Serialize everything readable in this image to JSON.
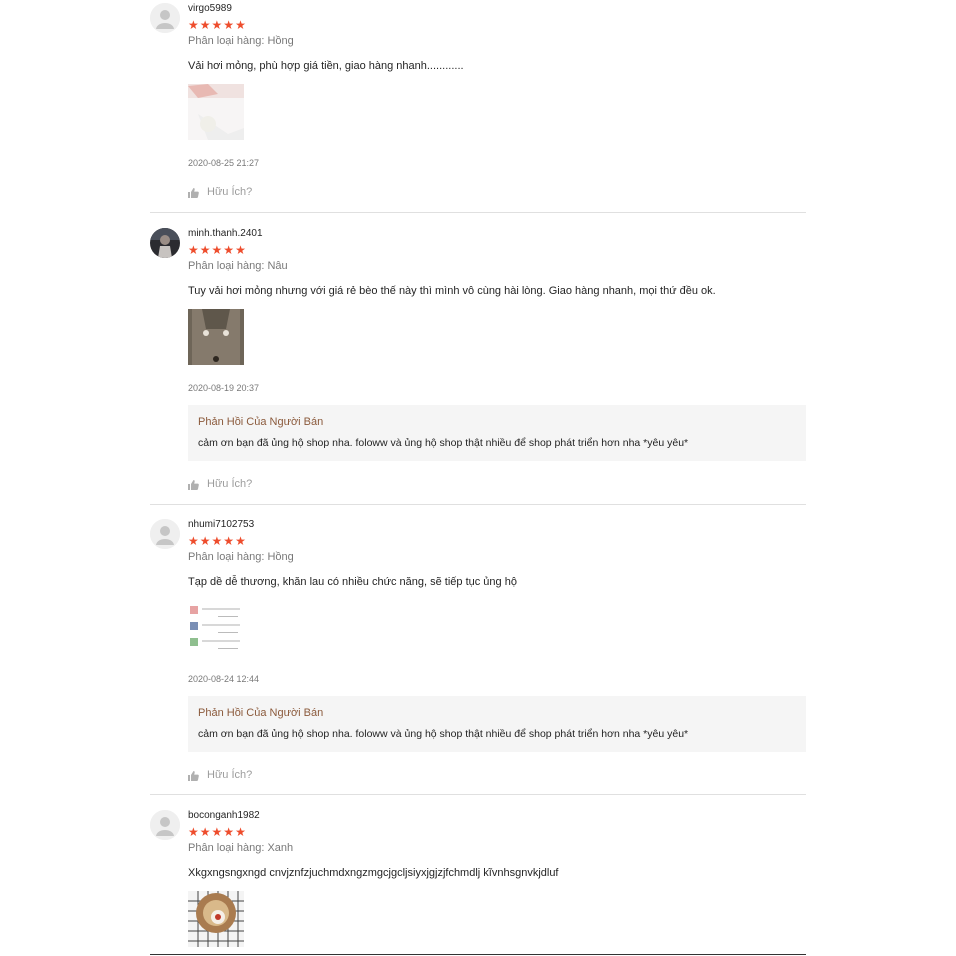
{
  "labels": {
    "variation_prefix": "Phân loại hàng:",
    "helpful": "Hữu Ích?",
    "seller_reply_title": "Phản Hồi Của Người Bán"
  },
  "colors": {
    "star": "#ee4d2d",
    "reply_title": "#8b5a3c",
    "reply_bg": "#f5f5f5"
  },
  "reviews": [
    {
      "username": "virgo5989",
      "rating": 5,
      "variation": "Hồng",
      "comment": "Vải hơi mỏng, phù hợp giá tiền, giao hàng nhanh............",
      "time": "2020-08-25 21:27"
    },
    {
      "username": "minh.thanh.2401",
      "rating": 5,
      "variation": "Nâu",
      "comment": "Tuy vải hơi mỏng nhưng với giá rẻ bèo thế này thì mình vô cùng hài lòng. Giao hàng nhanh, mọi thứ đều ok.",
      "time": "2020-08-19 20:37",
      "reply": "cảm ơn bạn đã ủng hộ shop nha. foloww và ủng hộ shop thật nhiều để shop phát triển hơn nha *yêu yêu*"
    },
    {
      "username": "nhumi7102753",
      "rating": 5,
      "variation": "Hồng",
      "comment": "Tạp dề dễ thương, khăn lau có nhiều chức năng, sẽ tiếp tục ủng hộ",
      "time": "2020-08-24 12:44",
      "reply": "cảm ơn bạn đã ủng hộ shop nha. foloww và ủng hộ shop thật nhiều để shop phát triển hơn nha *yêu yêu*"
    },
    {
      "username": "boconganh1982",
      "rating": 5,
      "variation": "Xanh",
      "comment": "Xkgxngsngxngd cnvjznfzjuchmdxngzmgcjgcljsiyxjgjzjfchmdlj kĩvnhsgnvkjdluf"
    }
  ]
}
